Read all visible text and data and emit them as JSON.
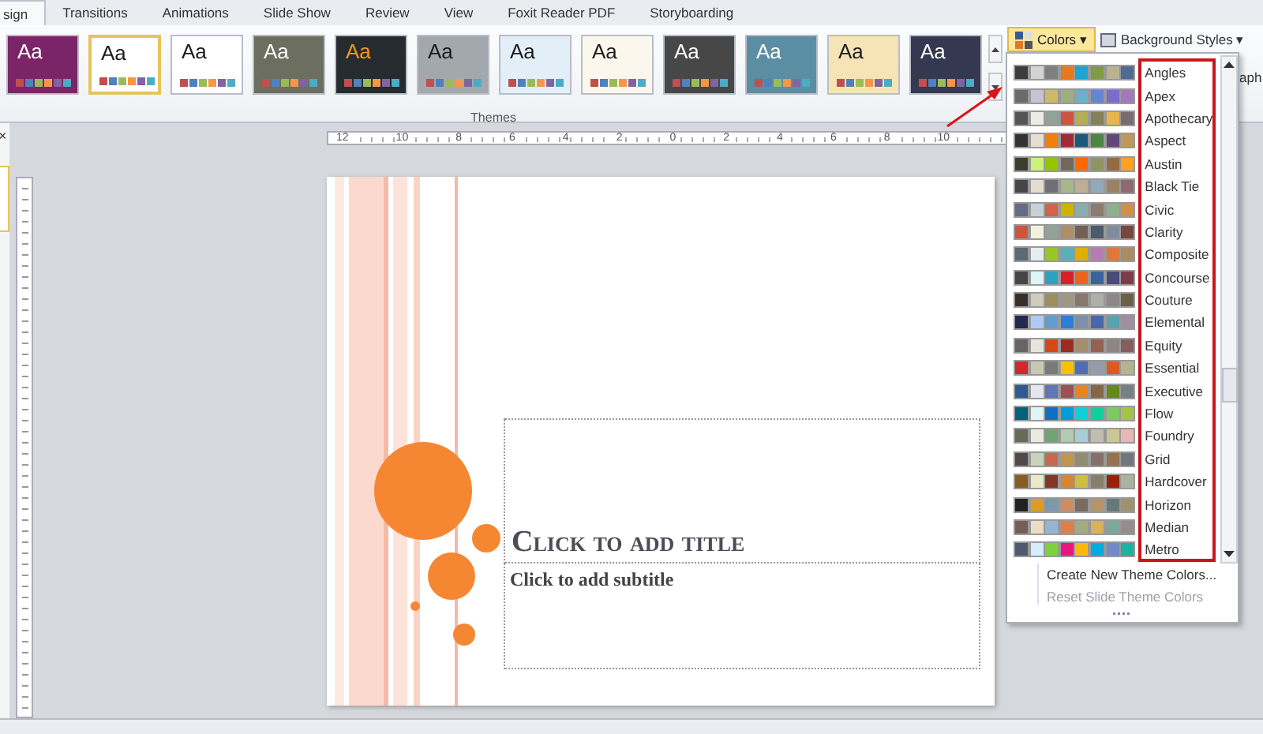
{
  "tabs": [
    {
      "label": "sign",
      "selected": true
    },
    {
      "label": "Transitions",
      "selected": false
    },
    {
      "label": "Animations",
      "selected": false
    },
    {
      "label": "Slide Show",
      "selected": false
    },
    {
      "label": "Review",
      "selected": false
    },
    {
      "label": "View",
      "selected": false
    },
    {
      "label": "Foxit Reader PDF",
      "selected": false
    },
    {
      "label": "Storyboarding",
      "selected": false
    }
  ],
  "themes": {
    "label": "Themes",
    "items": [
      {
        "label": "Aa",
        "selected": false,
        "kind": "dark",
        "color": "#7b2468"
      },
      {
        "label": "Aa",
        "selected": true,
        "kind": "light",
        "color": "#ffffff"
      },
      {
        "label": "Aa",
        "selected": false,
        "kind": "light",
        "color": "#ffffff"
      },
      {
        "label": "Aa",
        "selected": false,
        "kind": "dark",
        "color": "#6c6e60"
      },
      {
        "label": "Aa",
        "selected": false,
        "kind": "accent",
        "color": "#262b30"
      },
      {
        "label": "Aa",
        "selected": false,
        "kind": "light",
        "color": "#a3a8ad"
      },
      {
        "label": "Aa",
        "selected": false,
        "kind": "light",
        "color": "#e3eff8"
      },
      {
        "label": "Aa",
        "selected": false,
        "kind": "light",
        "color": "#fbf7ec"
      },
      {
        "label": "Aa",
        "selected": false,
        "kind": "dark",
        "color": "#474747"
      },
      {
        "label": "Aa",
        "selected": false,
        "kind": "dark",
        "color": "#5b8ea3"
      },
      {
        "label": "Aa",
        "selected": false,
        "kind": "light",
        "color": "#f6e4b6"
      },
      {
        "label": "Aa",
        "selected": false,
        "kind": "dark",
        "color": "#343850"
      }
    ]
  },
  "colors_button": {
    "label": "Colors",
    "caret": "▾"
  },
  "background_styles": {
    "label": "Background Styles",
    "caret": "▾"
  },
  "cut_label": "aph",
  "pane_close": "×",
  "ruler": {
    "labels": [
      "12",
      "10",
      "8",
      "6",
      "4",
      "2",
      "0",
      "2",
      "4",
      "6",
      "8",
      "10"
    ]
  },
  "slide": {
    "title": "Click to add title",
    "subtitle": "Click to add subtitle"
  },
  "colors_menu": {
    "palettes": [
      {
        "name": "Angles",
        "swatches": [
          {
            "color": "#3c3c3c"
          },
          {
            "color": "#d4d4d4"
          },
          {
            "color": "#7f7f7f"
          },
          {
            "color": "#e8781c"
          },
          {
            "color": "#1ba5d1"
          },
          {
            "color": "#7e9b46"
          },
          {
            "color": "#b9b38f"
          },
          {
            "color": "#4f6a93"
          }
        ]
      },
      {
        "name": "Apex",
        "swatches": [
          {
            "color": "#6b6b6b"
          },
          {
            "color": "#c9c2d1"
          },
          {
            "color": "#ceb966"
          },
          {
            "color": "#9cb084"
          },
          {
            "color": "#6bb1c9"
          },
          {
            "color": "#6585cf"
          },
          {
            "color": "#7e6bc9"
          },
          {
            "color": "#a379bb"
          }
        ]
      },
      {
        "name": "Apothecary",
        "swatches": [
          {
            "color": "#545454"
          },
          {
            "color": "#ecebe4"
          },
          {
            "color": "#93a299"
          },
          {
            "color": "#cf543f"
          },
          {
            "color": "#b5ae53"
          },
          {
            "color": "#848058"
          },
          {
            "color": "#e8b54d"
          },
          {
            "color": "#786c71"
          }
        ]
      },
      {
        "name": "Aspect",
        "swatches": [
          {
            "color": "#323232"
          },
          {
            "color": "#e3ded1"
          },
          {
            "color": "#f07f09"
          },
          {
            "color": "#9f2936"
          },
          {
            "color": "#1b587c"
          },
          {
            "color": "#4e8542"
          },
          {
            "color": "#604878"
          },
          {
            "color": "#c19859"
          }
        ]
      },
      {
        "name": "Austin",
        "swatches": [
          {
            "color": "#3e3d2d"
          },
          {
            "color": "#caf278"
          },
          {
            "color": "#94c600"
          },
          {
            "color": "#71685a"
          },
          {
            "color": "#ff6700"
          },
          {
            "color": "#909465"
          },
          {
            "color": "#956b43"
          },
          {
            "color": "#fea022"
          }
        ]
      },
      {
        "name": "Black Tie",
        "swatches": [
          {
            "color": "#46464a"
          },
          {
            "color": "#e3dcd0"
          },
          {
            "color": "#6f6f74"
          },
          {
            "color": "#a7b789"
          },
          {
            "color": "#beae98"
          },
          {
            "color": "#92a9b9"
          },
          {
            "color": "#9c8265"
          },
          {
            "color": "#8d6974"
          }
        ]
      },
      {
        "name": "Civic",
        "swatches": [
          {
            "color": "#646b86"
          },
          {
            "color": "#c5d1d7"
          },
          {
            "color": "#d16349"
          },
          {
            "color": "#ccb400"
          },
          {
            "color": "#8cadae"
          },
          {
            "color": "#8c7b70"
          },
          {
            "color": "#8fb08c"
          },
          {
            "color": "#d19049"
          }
        ]
      },
      {
        "name": "Clarity",
        "swatches": [
          {
            "color": "#d2533c"
          },
          {
            "color": "#f3f2dc"
          },
          {
            "color": "#93a299"
          },
          {
            "color": "#ad8f67"
          },
          {
            "color": "#726056"
          },
          {
            "color": "#4c5a6a"
          },
          {
            "color": "#808da0"
          },
          {
            "color": "#79463d"
          }
        ]
      },
      {
        "name": "Composite",
        "swatches": [
          {
            "color": "#5b6973"
          },
          {
            "color": "#e7ecec"
          },
          {
            "color": "#98c723"
          },
          {
            "color": "#59b0b9"
          },
          {
            "color": "#deae00"
          },
          {
            "color": "#b77bb4"
          },
          {
            "color": "#e0773c"
          },
          {
            "color": "#a98d63"
          }
        ]
      },
      {
        "name": "Concourse",
        "swatches": [
          {
            "color": "#464646"
          },
          {
            "color": "#def5fa"
          },
          {
            "color": "#2da2bf"
          },
          {
            "color": "#da1f28"
          },
          {
            "color": "#eb641b"
          },
          {
            "color": "#39639d"
          },
          {
            "color": "#474b78"
          },
          {
            "color": "#7d3c4a"
          }
        ]
      },
      {
        "name": "Couture",
        "swatches": [
          {
            "color": "#37302a"
          },
          {
            "color": "#d0ccb9"
          },
          {
            "color": "#9e8e5c"
          },
          {
            "color": "#a09781"
          },
          {
            "color": "#85776d"
          },
          {
            "color": "#aeafa9"
          },
          {
            "color": "#8d878b"
          },
          {
            "color": "#6b6149"
          }
        ]
      },
      {
        "name": "Elemental",
        "swatches": [
          {
            "color": "#242852"
          },
          {
            "color": "#accbf9"
          },
          {
            "color": "#629dd1"
          },
          {
            "color": "#297fd5"
          },
          {
            "color": "#7f8fa9"
          },
          {
            "color": "#4a66ac"
          },
          {
            "color": "#5aa2ae"
          },
          {
            "color": "#9d90a0"
          }
        ]
      },
      {
        "name": "Equity",
        "swatches": [
          {
            "color": "#696464"
          },
          {
            "color": "#e9e5dc"
          },
          {
            "color": "#d34817"
          },
          {
            "color": "#9b2d1f"
          },
          {
            "color": "#a28e6a"
          },
          {
            "color": "#956251"
          },
          {
            "color": "#918485"
          },
          {
            "color": "#855d5d"
          }
        ]
      },
      {
        "name": "Essential",
        "swatches": [
          {
            "color": "#d1282e"
          },
          {
            "color": "#c8c8b1"
          },
          {
            "color": "#7a7a7a"
          },
          {
            "color": "#f5c201"
          },
          {
            "color": "#526db0"
          },
          {
            "color": "#989aac"
          },
          {
            "color": "#dc5924"
          },
          {
            "color": "#b4b392"
          }
        ]
      },
      {
        "name": "Executive",
        "swatches": [
          {
            "color": "#2f5897"
          },
          {
            "color": "#e4e9ef"
          },
          {
            "color": "#6076b4"
          },
          {
            "color": "#9c5252"
          },
          {
            "color": "#e68422"
          },
          {
            "color": "#846648"
          },
          {
            "color": "#63891f"
          },
          {
            "color": "#758085"
          }
        ]
      },
      {
        "name": "Flow",
        "swatches": [
          {
            "color": "#04617b"
          },
          {
            "color": "#dbf5f9"
          },
          {
            "color": "#0f6fc6"
          },
          {
            "color": "#009dd9"
          },
          {
            "color": "#0bd0d9"
          },
          {
            "color": "#10cf9b"
          },
          {
            "color": "#7cca62"
          },
          {
            "color": "#a5c249"
          }
        ]
      },
      {
        "name": "Foundry",
        "swatches": [
          {
            "color": "#676a55"
          },
          {
            "color": "#eaebde"
          },
          {
            "color": "#72a376"
          },
          {
            "color": "#b0ccb0"
          },
          {
            "color": "#a8cdd7"
          },
          {
            "color": "#c0beaf"
          },
          {
            "color": "#cec597"
          },
          {
            "color": "#e8b7b7"
          }
        ]
      },
      {
        "name": "Grid",
        "swatches": [
          {
            "color": "#534949"
          },
          {
            "color": "#ccd1b9"
          },
          {
            "color": "#c66951"
          },
          {
            "color": "#bf974d"
          },
          {
            "color": "#928b70"
          },
          {
            "color": "#87706b"
          },
          {
            "color": "#94734e"
          },
          {
            "color": "#6f777d"
          }
        ]
      },
      {
        "name": "Hardcover",
        "swatches": [
          {
            "color": "#895d1d"
          },
          {
            "color": "#ece9c6"
          },
          {
            "color": "#873624"
          },
          {
            "color": "#d6862d"
          },
          {
            "color": "#d0be40"
          },
          {
            "color": "#877f6c"
          },
          {
            "color": "#972109"
          },
          {
            "color": "#aab39f"
          }
        ]
      },
      {
        "name": "Horizon",
        "swatches": [
          {
            "color": "#1f2123"
          },
          {
            "color": "#dc9e1f"
          },
          {
            "color": "#7e97ad"
          },
          {
            "color": "#cc8e60"
          },
          {
            "color": "#7a6a60"
          },
          {
            "color": "#b4936d"
          },
          {
            "color": "#67787b"
          },
          {
            "color": "#9d936f"
          }
        ]
      },
      {
        "name": "Median",
        "swatches": [
          {
            "color": "#775f55"
          },
          {
            "color": "#ebddc3"
          },
          {
            "color": "#94b6d2"
          },
          {
            "color": "#dd8047"
          },
          {
            "color": "#a5ab81"
          },
          {
            "color": "#d8b25c"
          },
          {
            "color": "#7ba79d"
          },
          {
            "color": "#968c8c"
          }
        ]
      },
      {
        "name": "Metro",
        "swatches": [
          {
            "color": "#4e5b6f"
          },
          {
            "color": "#d6ecff"
          },
          {
            "color": "#7fd13b"
          },
          {
            "color": "#ea157a"
          },
          {
            "color": "#feb80a"
          },
          {
            "color": "#00addc"
          },
          {
            "color": "#738ac8"
          },
          {
            "color": "#1ab39f"
          }
        ]
      }
    ],
    "actions": [
      {
        "label": "Create New Theme Colors...",
        "disabled": false
      },
      {
        "label": "Reset Slide Theme Colors",
        "disabled": true
      }
    ]
  }
}
